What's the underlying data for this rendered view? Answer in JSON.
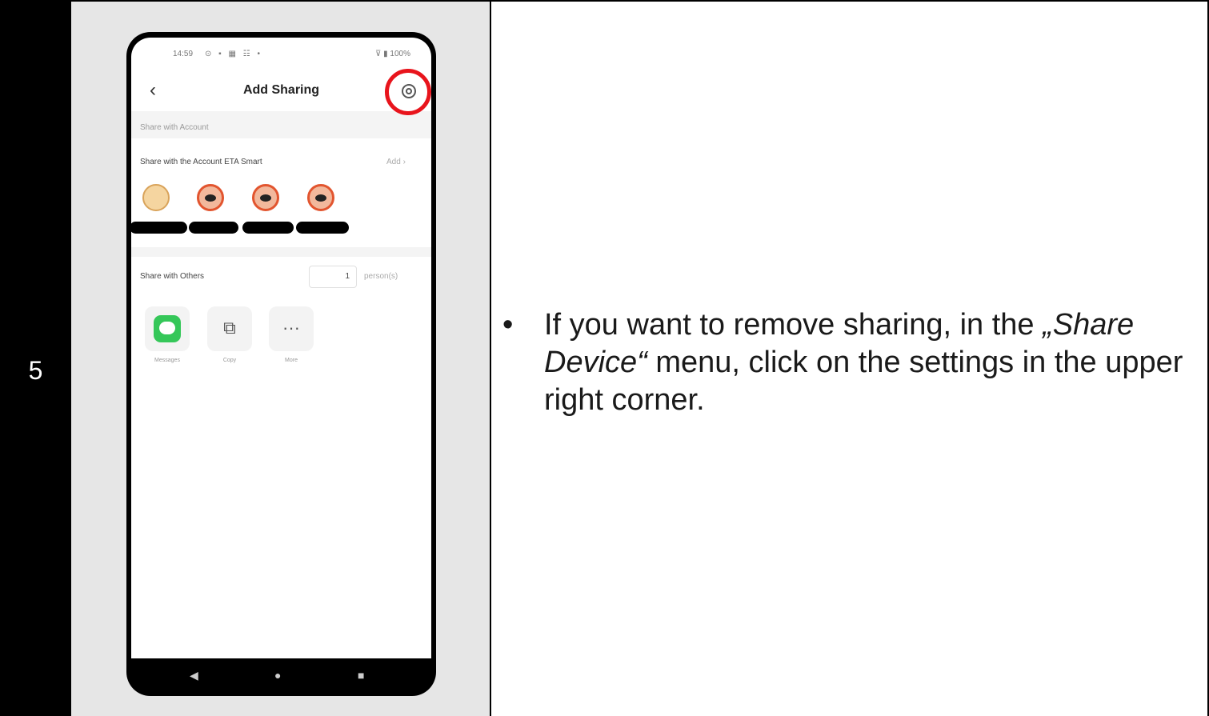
{
  "step": {
    "number": "5"
  },
  "instruction": {
    "bullet": "•",
    "prefix": "If you want to remove sharing, in the ",
    "menu_name": "„Share Device“",
    "suffix": " menu, click on the settings in the upper right corner."
  },
  "phone": {
    "status_bar": {
      "time": "14:59",
      "icons": "⊙ ▪ ▦ ☷ •",
      "right": "⊽ ▮ 100%"
    },
    "header": {
      "back": "‹",
      "title": "Add Sharing"
    },
    "sections": {
      "share_with_account": {
        "label": "Share with Account",
        "row_label": "Share with the Account ETA Smart",
        "action": "Add ›"
      },
      "share_with_others": {
        "row_label": "Share with Others",
        "count": "1",
        "unit": "person(s)",
        "options": [
          {
            "label": "Messages",
            "icon": "messages-icon"
          },
          {
            "label": "Copy",
            "icon": "copy-icon"
          },
          {
            "label": "More",
            "icon": "more-icon"
          }
        ]
      }
    },
    "nav": {
      "back": "◀",
      "home": "●",
      "recents": "■"
    }
  },
  "colors": {
    "highlight": "#e8141c",
    "messages_green": "#35c759",
    "step_bg": "#000000"
  }
}
